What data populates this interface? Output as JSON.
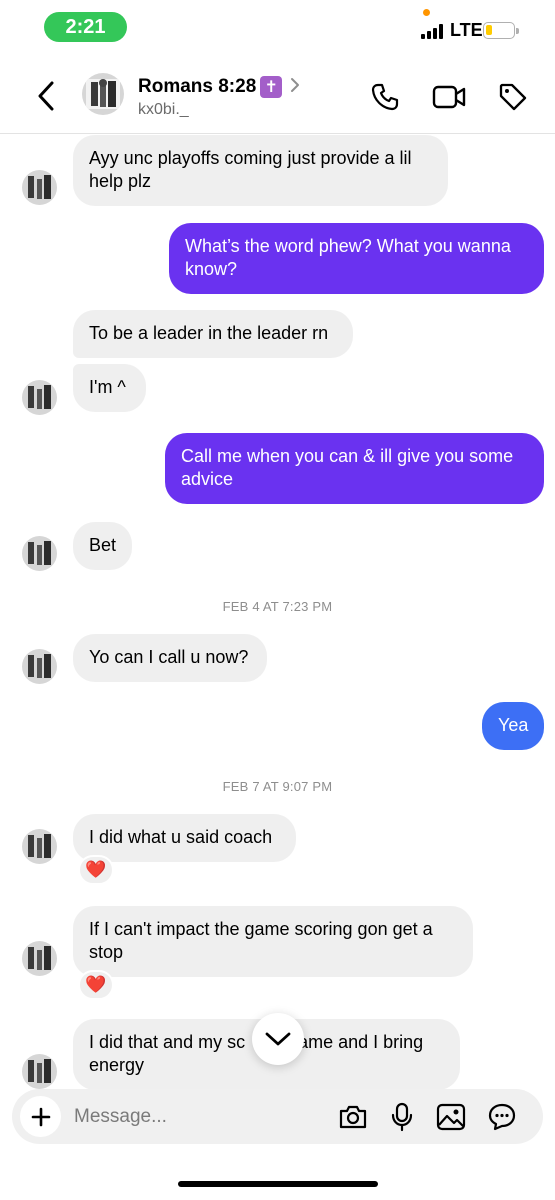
{
  "status_bar": {
    "time": "2:21",
    "network": "LTE"
  },
  "header": {
    "contact_name": "Romans 8:28",
    "name_badge": "✝",
    "handle": "kx0bi._"
  },
  "messages": {
    "m1": "Ayy unc playoffs coming just provide a lil help plz",
    "m2": "What’s the word phew? What you wanna know?",
    "m3": "To be a leader in the leader rn",
    "m4": "I'm ^",
    "m5": "Call me when you can & ill give you some advice",
    "m6": "Bet",
    "d1": "FEB 4 AT 7:23 PM",
    "m7": "Yo can I call u now?",
    "m8": "Yea",
    "d2": "FEB 7 AT 9:07 PM",
    "m9": "I did what u said coach",
    "m10": "If I can't impact the game scoring gon get a stop",
    "m11_part1": "I did that and my sc",
    "m11_part2": "came and I bring energy",
    "reaction": "❤️"
  },
  "composer": {
    "placeholder": "Message..."
  },
  "colors": {
    "outgoing": "#6a32f0",
    "outgoing_blue": "#3d6ff5",
    "incoming": "#efefef",
    "status_green": "#34c759"
  }
}
